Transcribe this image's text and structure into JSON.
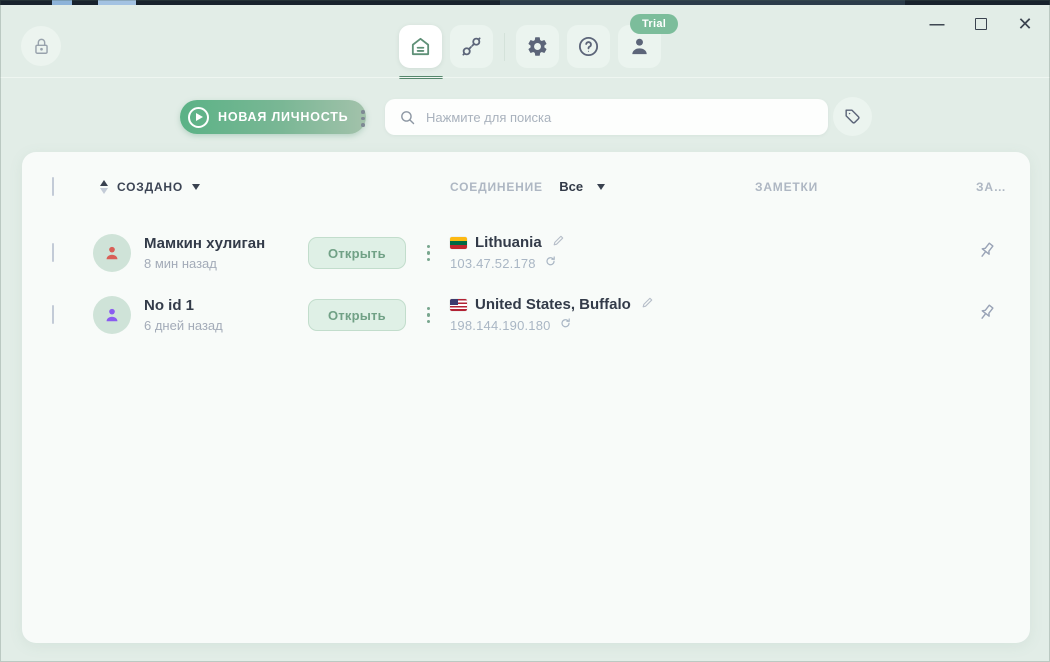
{
  "window": {
    "minimize_glyph": "—",
    "close_glyph": "✕",
    "trial_badge": "Trial"
  },
  "nav": {
    "items": [
      {
        "id": "home",
        "active": true
      },
      {
        "id": "connections",
        "active": false
      },
      {
        "id": "settings",
        "active": false
      },
      {
        "id": "help",
        "active": false
      },
      {
        "id": "account",
        "active": false
      }
    ]
  },
  "toolbar": {
    "new_identity_label": "НОВАЯ ЛИЧНОСТЬ",
    "search_placeholder": "Нажмите для поиска"
  },
  "table": {
    "headers": {
      "created": "СОЗДАНО",
      "connection": "СОЕДИНЕНИЕ",
      "connection_filter": "Все",
      "notes": "ЗАМЕТКИ",
      "pinned_truncated": "ЗА…"
    },
    "rows": [
      {
        "name": "Мамкин хулиган",
        "created": "8 мин назад",
        "open_label": "Открыть",
        "country": "Lithuania",
        "ip": "103.47.52.178",
        "flag": "lithuania-flag",
        "notes": ""
      },
      {
        "name": "No id 1",
        "created": "6 дней назад",
        "open_label": "Открыть",
        "country": "United States, Buffalo",
        "ip": "198.144.190.180",
        "flag": "us-flag",
        "notes": ""
      }
    ]
  },
  "colors": {
    "background": "#e2ede7",
    "card": "#f8fbf9",
    "accent_green": "#5bb286",
    "active_icon_green": "#5f9077",
    "trial_badge_green": "#7cbd9b",
    "open_button_bg": "#dff0e6",
    "open_button_text": "#71a186",
    "avatar_bg": "#cfe3d8",
    "avatar_red": "#d95f57",
    "avatar_purple": "#8a5cf0",
    "muted_text": "#a9b6c4",
    "dark_text": "#333b49"
  }
}
